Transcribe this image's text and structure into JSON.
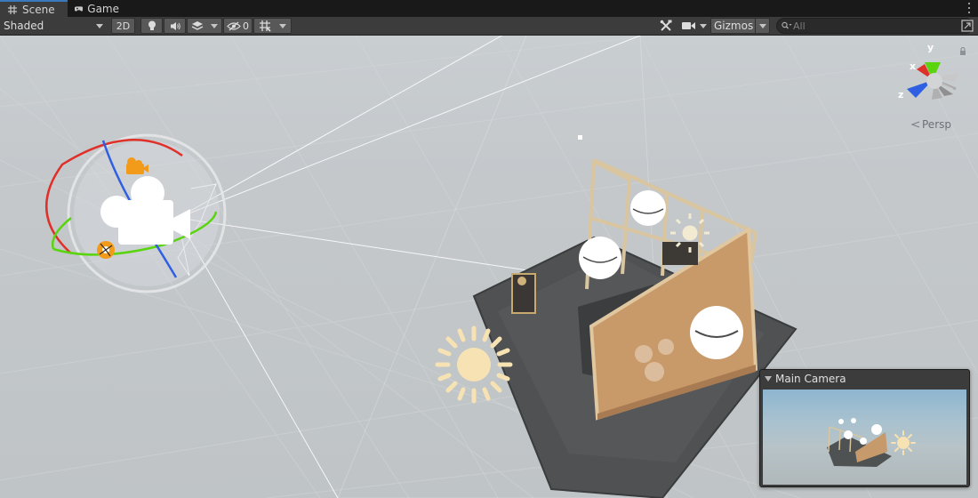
{
  "tabs": [
    {
      "label": "Scene",
      "icon": "grid-icon",
      "active": true
    },
    {
      "label": "Game",
      "icon": "gamepad-icon",
      "active": false
    }
  ],
  "toolbar": {
    "shading_mode": "Shaded",
    "mode_2d": "2D",
    "hidden_count": "0",
    "gizmos_label": "Gizmos",
    "search_placeholder": "All"
  },
  "scene": {
    "projection_label": "Persp",
    "axis_labels": {
      "x": "x",
      "y": "y",
      "z": "z"
    }
  },
  "preview": {
    "title": "Main Camera"
  },
  "colors": {
    "accent": "#3a79bb",
    "axis_x": "#e0302a",
    "axis_y": "#59d40e",
    "axis_z": "#2f5fe2",
    "camera_gizmo": "#f29a1a",
    "light_gizmo": "#f7e2b4"
  }
}
